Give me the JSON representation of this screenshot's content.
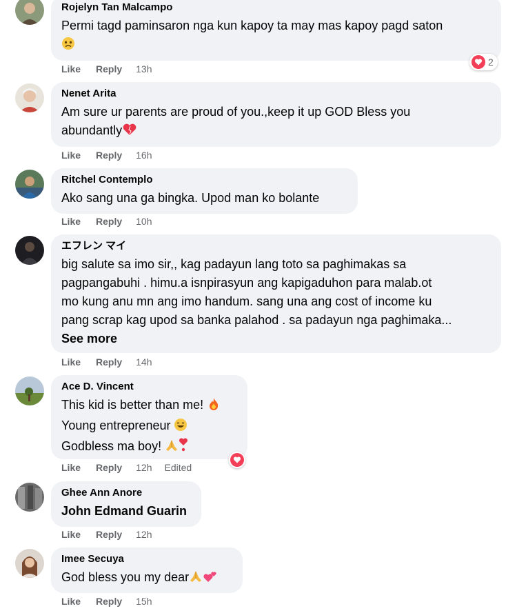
{
  "colors": {
    "bubble": "#f0f2f5",
    "meta": "#65676b",
    "text": "#050505",
    "love": "#f33e58"
  },
  "actions": {
    "like": "Like",
    "reply": "Reply",
    "edited": "Edited",
    "see_more": "See more"
  },
  "comments": [
    {
      "name": "Rojelyn Tan Malcampo",
      "lines": [
        "Permi tagd paminsaron nga kun kapoy ta may mas kapoy pagd saton"
      ],
      "time": "13h",
      "reactions": "2"
    },
    {
      "name": "Nenet Arita",
      "lines": [
        "Am sure ur parents are proud of you.,keep it up GOD Bless you",
        "abundantly"
      ],
      "time": "16h"
    },
    {
      "name": "Ritchel Contemplo",
      "lines": [
        "Ako sang una ga bingka. Upod man ko bolante"
      ],
      "time": "10h"
    },
    {
      "name": "エフレン マイ",
      "lines": [
        "big salute sa imo sir,, kag padayun lang toto sa paghimakas sa",
        "pagpangabuhi . himu.a isnpirasyun ang kapigaduhon para malab.ot",
        "mo kung anu mn ang imo handum. sang una ang cost of income ku",
        "pang scrap kag upod sa banka palahod . sa padayun nga paghimaka..."
      ],
      "time": "14h"
    },
    {
      "name": "Ace D. Vincent",
      "lines": [
        "This kid is better than me!",
        "Young entrepreneur",
        "Godbless ma boy!"
      ],
      "time": "12h"
    },
    {
      "name": "Ghee Ann Anore",
      "mention": "John Edmand Guarin",
      "time": "12h"
    },
    {
      "name": "Imee Secuya",
      "lines": [
        "God bless you my dear"
      ],
      "time": "15h"
    }
  ]
}
